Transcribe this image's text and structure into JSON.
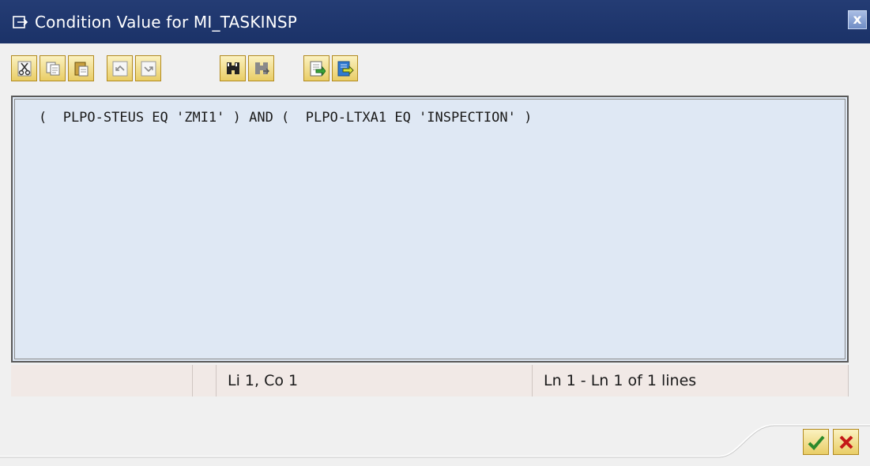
{
  "window": {
    "title": "Condition Value for MI_TASKINSP",
    "close_label": "x"
  },
  "toolbar": {
    "buttons": [
      "cut-icon",
      "copy-icon",
      "paste-icon",
      "undo-icon",
      "redo-icon",
      "find-icon",
      "find-next-icon",
      "import-icon",
      "export-icon"
    ]
  },
  "editor": {
    "content": "(  PLPO-STEUS EQ 'ZMI1' ) AND (  PLPO-LTXA1 EQ 'INSPECTION' )"
  },
  "status": {
    "segment1": "",
    "cursor": "Li 1, Co 1",
    "lines": "Ln 1 - Ln 1 of 1 lines"
  },
  "actions": {
    "ok_icon": "checkmark-icon",
    "cancel_icon": "cancel-icon"
  },
  "colors": {
    "titlebar": "#1f366c",
    "editor_bg": "#dfe8f4",
    "button_bg": "#f2dc8a"
  }
}
